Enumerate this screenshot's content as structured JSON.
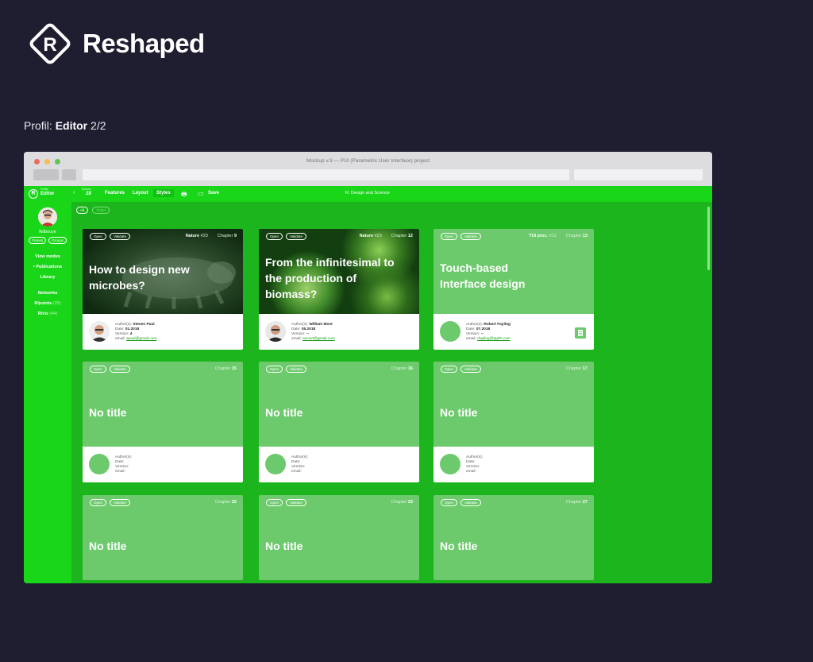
{
  "brand": {
    "name": "Reshaped",
    "logo_letter": "R"
  },
  "profil": {
    "prefix": "Profil:",
    "role": "Editor",
    "page": "2/2"
  },
  "window": {
    "title": "Mockup v.3 — PUI (Parametric User Interface) project",
    "dot_colors": [
      "#ec6a5f",
      "#f4bf4f",
      "#61c554"
    ]
  },
  "appbar": {
    "logo_letter": "R",
    "profile_small": "Profile",
    "profile": "Editor",
    "spaces_small": "Spaces",
    "spaces": "28",
    "tabs": [
      "Features",
      "Layout",
      "Styles"
    ],
    "save": "Save",
    "center": "R: Design and Science"
  },
  "sidebar": {
    "user": "fkilbouve",
    "pills": [
      "Frenes",
      "Groups"
    ],
    "nav": [
      "View modes",
      "Publications",
      "Library"
    ],
    "networks": "Networks",
    "points": {
      "label": "R/points",
      "count": "(25)"
    },
    "viz": {
      "label": "R/viz",
      "count": "(44)"
    }
  },
  "filters": [
    "All",
    "Ticket"
  ],
  "card_labels": {
    "open": "Open",
    "validate": "Validate",
    "chapter": "Chapter",
    "authors": "Author(s):",
    "date": "Date:",
    "version": "Version:",
    "email": "email:"
  },
  "cards": [
    {
      "source": "Nature",
      "source_num": "#23",
      "chapter": "9",
      "title": "How to design new microbes?",
      "author": "Steven Paul",
      "date": "01.2018",
      "version": "4",
      "email": "spaul@gmail.com"
    },
    {
      "source": "Nature",
      "source_num": "#23",
      "chapter": "12",
      "title": "From the infinitesimal to the production of biomass?",
      "author": "William Movt",
      "date": "05.2018",
      "version": "--",
      "email": "wmovt@gmail.com"
    },
    {
      "source": "TUI proc.",
      "source_num": "#12",
      "chapter": "13",
      "title": "Touch-based Interface design",
      "author": "Robert Fayling",
      "date": "07.2018",
      "version": "--",
      "email": "rfayling@tppfrt.com"
    },
    {
      "chapter": "15",
      "title": "No title"
    },
    {
      "chapter": "16",
      "title": "No title"
    },
    {
      "chapter": "17",
      "title": "No title"
    },
    {
      "chapter": "22",
      "title": "No title"
    },
    {
      "chapter": "23",
      "title": "No title"
    },
    {
      "chapter": "27",
      "title": "No title"
    }
  ]
}
